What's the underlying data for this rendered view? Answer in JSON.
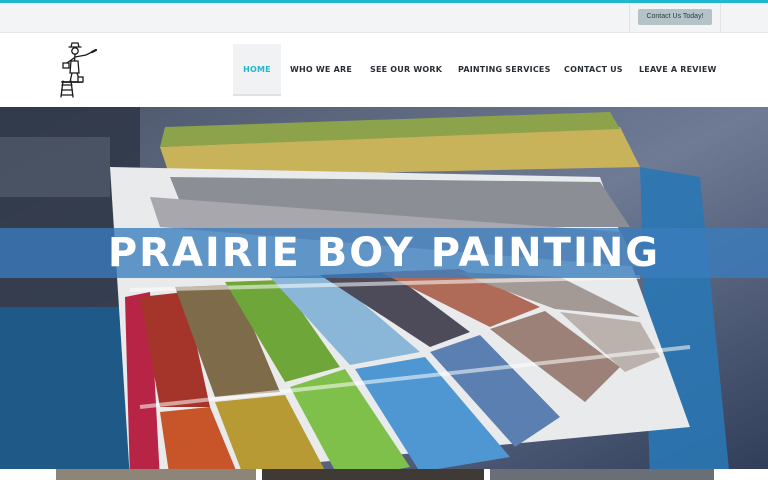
{
  "topbar": {
    "contact_button": "Contact Us Today!"
  },
  "header": {
    "logo_icon": "painter-on-ladder-logo",
    "nav": [
      {
        "label": "HOME",
        "active": true
      },
      {
        "label": "WHO WE ARE",
        "active": false
      },
      {
        "label": "SEE OUR WORK",
        "active": false
      },
      {
        "label": "PAINTING SERVICES",
        "active": false
      },
      {
        "label": "CONTACT US",
        "active": false
      },
      {
        "label": "LEAVE A REVIEW",
        "active": false
      }
    ]
  },
  "hero": {
    "title": "PRAIRIE BOY PAINTING",
    "image": "paint-color-swatch-fan"
  },
  "colors": {
    "accent": "#1fb8cf",
    "banner": "#3a7cbe",
    "button": "#b4c3c7"
  }
}
